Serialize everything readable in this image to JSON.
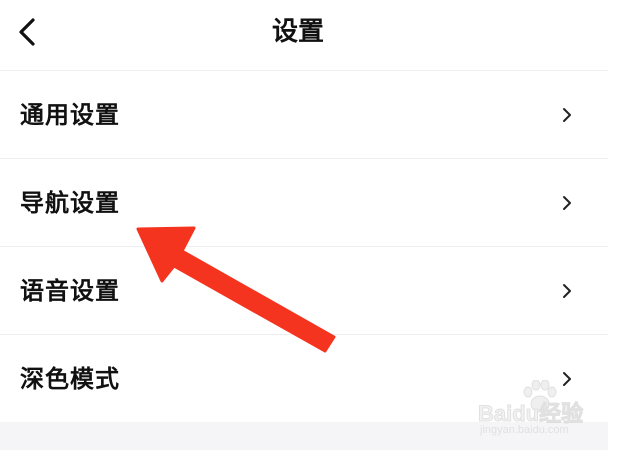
{
  "header": {
    "title": "设置",
    "back_icon": "chevron-left-icon"
  },
  "menu": {
    "items": [
      {
        "label": "通用设置",
        "icon": "chevron-right-icon"
      },
      {
        "label": "导航设置",
        "icon": "chevron-right-icon"
      },
      {
        "label": "语音设置",
        "icon": "chevron-right-icon"
      },
      {
        "label": "深色模式",
        "icon": "chevron-right-icon"
      }
    ]
  },
  "annotation": {
    "arrow_color": "#f5341f",
    "target_item": "导航设置"
  },
  "watermark": {
    "brand": "Baidu经验",
    "url": "jingyan.baidu.com"
  },
  "colors": {
    "background": "#ffffff",
    "text": "#111111",
    "divider": "#eeeef0",
    "footer_band": "#f5f5f7"
  }
}
